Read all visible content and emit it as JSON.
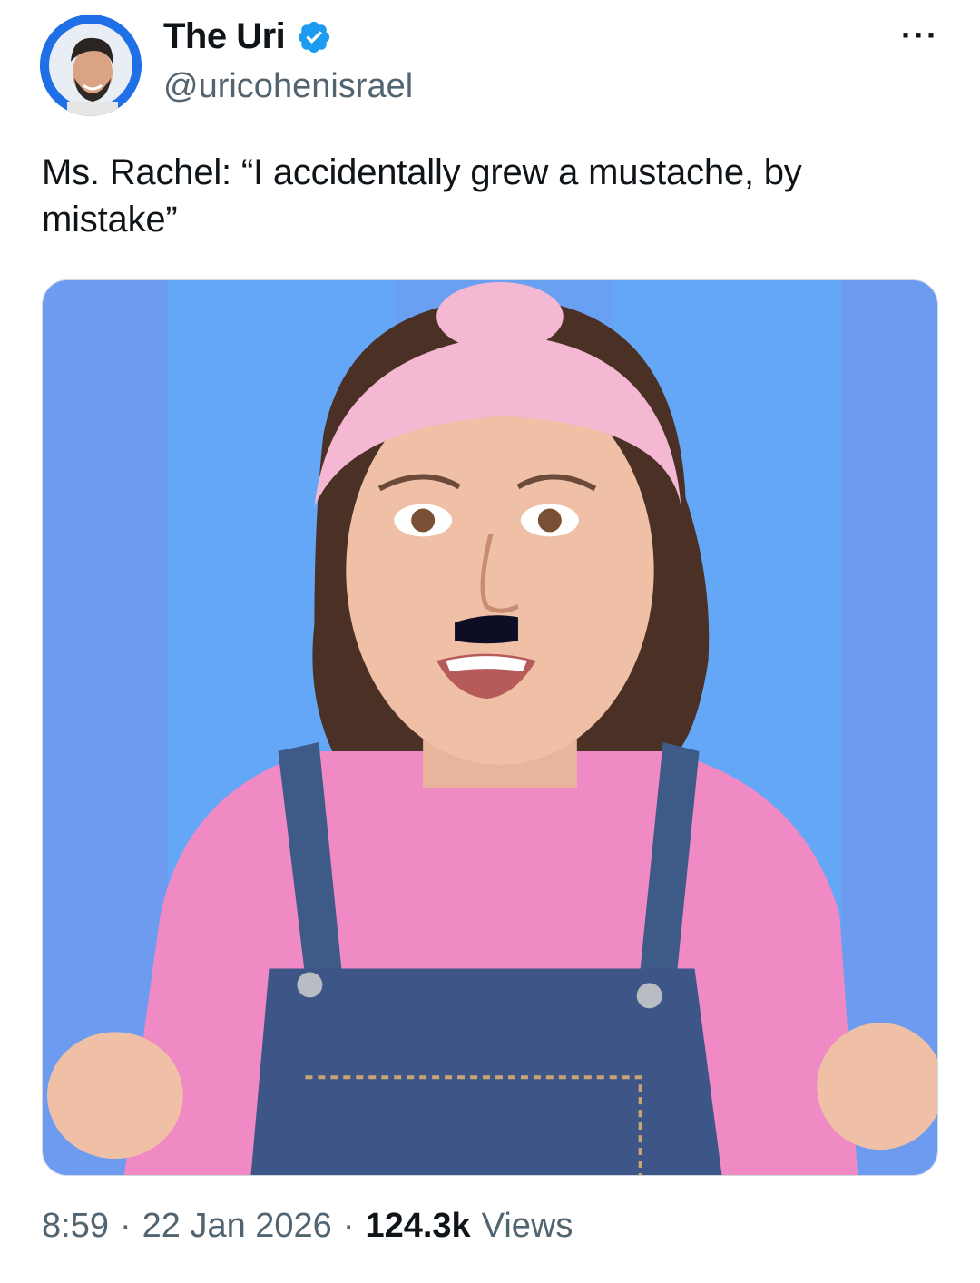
{
  "post": {
    "author": {
      "display_name": "The Uri",
      "handle": "@uricohenisrael",
      "verified": true,
      "verified_icon": "verified-badge-icon",
      "avatar_icon": "avatar"
    },
    "more_icon": "more-options-icon",
    "text": "Ms. Rachel: “I accidentally grew a mustache, by mistake”",
    "media": {
      "kind": "photo",
      "background_colors": [
        "#6d9bef",
        "#63a7f6"
      ]
    },
    "meta": {
      "time": "8:59",
      "separator": "·",
      "date": "22 Jan 2026",
      "views_count": "124.3k",
      "views_label": "Views"
    }
  },
  "colors": {
    "text_primary": "#0f1419",
    "text_secondary": "#536471",
    "verified_blue": "#1d9bf0"
  }
}
